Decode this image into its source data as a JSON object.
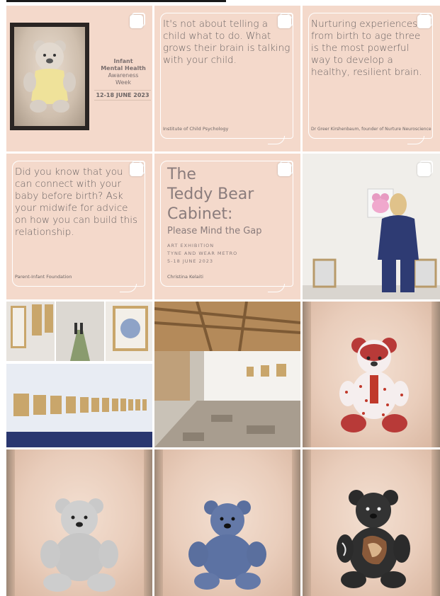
{
  "tiles": {
    "t1": {
      "event_line1": "Infant",
      "event_line2": "Mental Health",
      "event_line3": "Awareness",
      "event_line4": "Week",
      "dates": "12-18 JUNE 2023"
    },
    "t2": {
      "quote": "It's not about telling a child what to do. What grows their brain is talking with your child.",
      "credit": "Institute of Child Psychology"
    },
    "t3": {
      "quote": "Nurturing experiences from birth to age three is the most powerful way to develop a healthy, resilient brain.",
      "credit": "Dr Greer Kirshenbaum, founder of Nurture Neuroscience"
    },
    "t4": {
      "quote": "Did you know that you can connect with your baby before birth? Ask your midwife for advice on how you can build this relationship.",
      "credit": "Parent-Infant Foundation"
    },
    "t5": {
      "title_l1": "The",
      "title_l2": "Teddy Bear",
      "title_l3": "Cabinet:",
      "subtitle": "Please Mind the Gap",
      "line1": "ART EXHIBITION",
      "line2": "TYNE AND WEAR METRO",
      "line3": "5-18 JUNE 2023",
      "artist": "Christina Kelaiti"
    }
  },
  "colors": {
    "tile_pink": "#f4d9cb",
    "text_muted": "#6b6464",
    "bear_red": "#c0392b",
    "bear_grey": "#bdbdbd",
    "bear_blue": "#5c74a8",
    "bear_black": "#2b2b2b"
  }
}
